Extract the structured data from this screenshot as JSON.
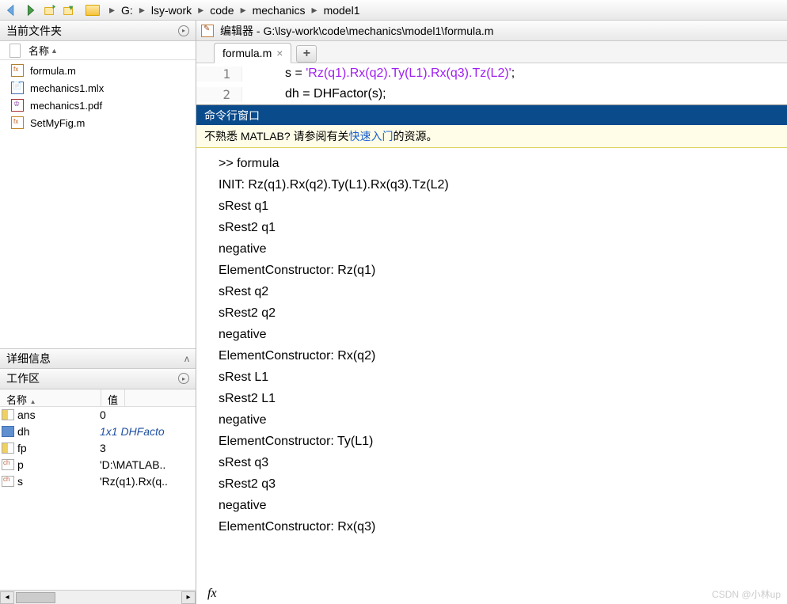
{
  "breadcrumb": {
    "drive": "G:",
    "parts": [
      "lsy-work",
      "code",
      "mechanics",
      "model1"
    ]
  },
  "current_folder": {
    "title": "当前文件夹",
    "name_col": "名称",
    "files": [
      {
        "name": "formula.m",
        "icon": "m"
      },
      {
        "name": "mechanics1.mlx",
        "icon": "mlx"
      },
      {
        "name": "mechanics1.pdf",
        "icon": "pdf"
      },
      {
        "name": "SetMyFig.m",
        "icon": "fig"
      }
    ]
  },
  "details": {
    "title": "详细信息"
  },
  "workspace": {
    "title": "工作区",
    "name_col": "名称",
    "value_col": "值",
    "vars": [
      {
        "name": "ans",
        "value": "0",
        "icon": "grid"
      },
      {
        "name": "dh",
        "value": "1x1 DHFacto",
        "icon": "cube",
        "italic": true
      },
      {
        "name": "fp",
        "value": "3",
        "icon": "grid"
      },
      {
        "name": "p",
        "value": "'D:\\MATLAB..",
        "icon": "ch"
      },
      {
        "name": "s",
        "value": "'Rz(q1).Rx(q..",
        "icon": "ch"
      }
    ]
  },
  "editor": {
    "title": "编辑器 - G:\\lsy-work\\code\\mechanics\\model1\\formula.m",
    "tab": "formula.m",
    "lines": [
      {
        "n": "1",
        "pre": "s = ",
        "str": "'Rz(q1).Rx(q2).Ty(L1).Rx(q3).Tz(L2)'",
        "post": ";"
      },
      {
        "n": "2",
        "pre": "dh = DHFactor(s);",
        "str": "",
        "post": ""
      }
    ]
  },
  "command": {
    "title": "命令行窗口",
    "banner_pre": "不熟悉 MATLAB? 请参阅有关",
    "banner_link": "快速入门",
    "banner_post": "的资源。",
    "lines": [
      ">> formula",
      "INIT: Rz(q1).Rx(q2).Ty(L1).Rx(q3).Tz(L2)",
      "sRest q1",
      "sRest2 q1",
      "negative",
      "ElementConstructor: Rz(q1)",
      "sRest q2",
      "sRest2 q2",
      "negative",
      "ElementConstructor: Rx(q2)",
      "sRest L1",
      "sRest2 L1",
      "negative",
      "ElementConstructor: Ty(L1)",
      "sRest q3",
      "sRest2 q3",
      "negative",
      "ElementConstructor: Rx(q3)"
    ]
  },
  "watermark": "CSDN @小林up"
}
